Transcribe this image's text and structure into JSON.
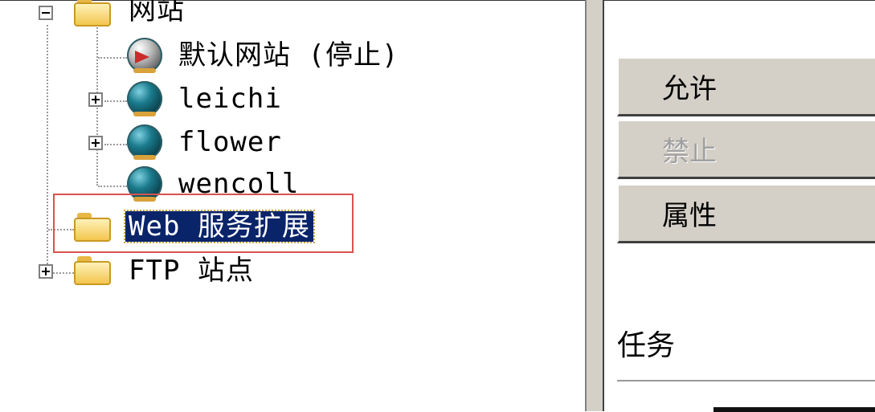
{
  "tree": {
    "nodes": [
      {
        "label": "网站",
        "state": "expanded",
        "icon": "folder-icon"
      },
      {
        "label": "默认网站 (停止)",
        "icon": "stopped-site-icon"
      },
      {
        "label": "leichi",
        "state": "collapsed",
        "icon": "globe-icon"
      },
      {
        "label": "flower",
        "state": "collapsed",
        "icon": "globe-icon"
      },
      {
        "label": "wencoll",
        "icon": "globe-icon"
      },
      {
        "label": "Web 服务扩展",
        "icon": "folder-icon",
        "selected": true
      },
      {
        "label": "FTP 站点",
        "state": "collapsed",
        "icon": "folder-icon"
      }
    ]
  },
  "actions": {
    "allow_label": "允许",
    "deny_label": "禁止",
    "properties_label": "属性"
  },
  "tasks": {
    "label": "任务"
  },
  "colors": {
    "selection": "#0a246a",
    "highlight_box": "#d9534f",
    "panel": "#d4d0c8"
  }
}
